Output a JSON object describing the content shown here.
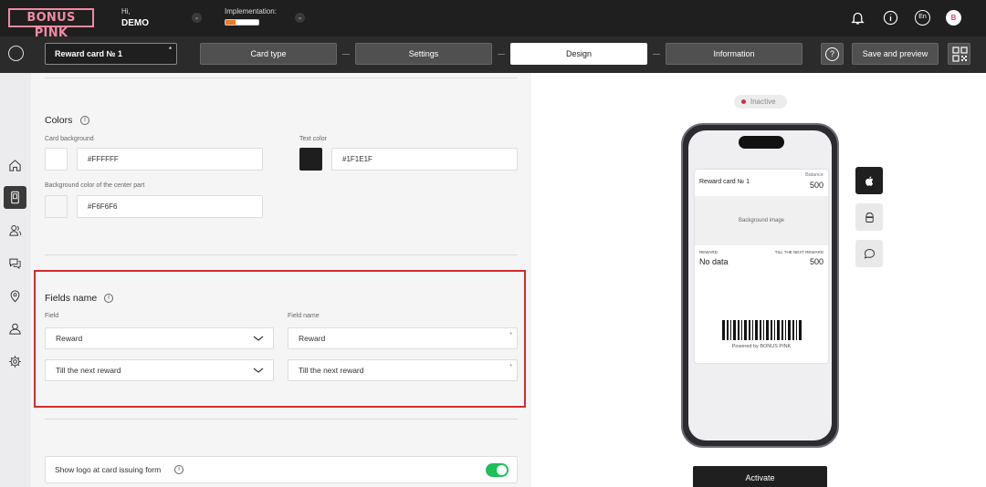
{
  "header": {
    "logo": "BONUS PINK",
    "greeting": "Hi,",
    "user": "DEMO",
    "implementation_label": "Implementation:",
    "implementation_progress": 0.3,
    "language": "En",
    "avatar_letter": "B"
  },
  "toolbar": {
    "card_name": "Reward card № 1",
    "required_mark": "*",
    "steps": [
      {
        "label": "Card type"
      },
      {
        "label": "Settings"
      },
      {
        "label": "Design"
      },
      {
        "label": "Information"
      }
    ],
    "active_step": "Design",
    "help_label": "?",
    "save_label": "Save and preview"
  },
  "colors_section": {
    "title": "Colors",
    "info": "i",
    "card_background_label": "Card background",
    "card_background_value": "#FFFFFF",
    "text_color_label": "Text color",
    "text_color_value": "#1F1E1F",
    "center_bg_label": "Background color of the center part",
    "center_bg_value": "#F6F6F6"
  },
  "fields_section": {
    "title": "Fields name",
    "info": "i",
    "field_col_label": "Field",
    "name_col_label": "Field name",
    "rows": [
      {
        "field": "Reward",
        "name": "Reward",
        "req": "*"
      },
      {
        "field": "Till the next reward",
        "name": "Till the next reward",
        "req": "*"
      }
    ]
  },
  "logo_toggle": {
    "label": "Show logo at card issuing form",
    "info": "i",
    "enabled": true
  },
  "preview": {
    "status": "Inactive",
    "card": {
      "name": "Reward card № 1",
      "balance_label": "Balance",
      "balance_value": "500",
      "background_label": "Background image",
      "field1_label": "REWARD",
      "field1_value": "No data",
      "field2_label": "TILL THE NEXT REWARD",
      "field2_value": "500",
      "powered": "Powered by BONUS PINK"
    },
    "activate_label": "Activate"
  },
  "colors": {
    "accent_pink": "#f08aa2",
    "highlight_red": "#d42b2b",
    "toggle_green": "#1fbf5a",
    "progress_orange": "#f07a2a"
  }
}
